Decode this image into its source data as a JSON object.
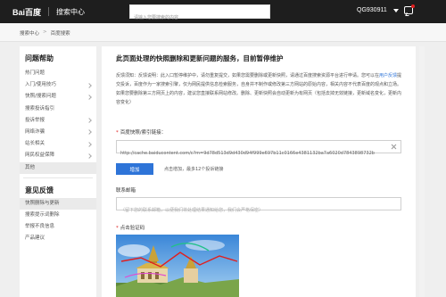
{
  "header": {
    "logo_text": "Bai百度",
    "logo_sub": "搜索中心",
    "search_placeholder": "请输入您要搜索的内容",
    "user_name": "QG930911",
    "colors": {
      "bar": "#1e1e1e",
      "accent": "#2e5bff"
    }
  },
  "breadcrumb": {
    "items": [
      "搜索中心",
      "百度搜索"
    ],
    "separator": ">"
  },
  "sidebar": {
    "title": "问题帮助",
    "items": [
      {
        "label": "热门问题",
        "has_chevron": false
      },
      {
        "label": "入门/使用技巧",
        "has_chevron": true
      },
      {
        "label": "快照/搜索问题",
        "has_chevron": true
      },
      {
        "label": "搜索投诉指引",
        "has_chevron": false
      },
      {
        "label": "投诉举报",
        "has_chevron": true
      },
      {
        "label": "网络诈骗",
        "has_chevron": true
      },
      {
        "label": "站长相关",
        "has_chevron": true
      },
      {
        "label": "网民权益保障",
        "has_chevron": true
      },
      {
        "label": "其他",
        "has_chevron": false,
        "active": true
      }
    ],
    "title2": "意见反馈",
    "feedback_items": [
      {
        "label": "快照删除与更新",
        "active": true
      },
      {
        "label": "搜索提示词删除"
      },
      {
        "label": "举报不良信息"
      },
      {
        "label": "产品建议"
      }
    ]
  },
  "main": {
    "page_title": "此页面处理的快照删除和更新问题的服务，目前暂停维护",
    "notice_before_link": "反馈须知：反馈说明：此入口暂停维护中，请勿重复提交，如果您需要删除或更新快照，请通过百度搜索资源平台进行申请。您可以在",
    "notice_link": "用户反馈",
    "notice_after_link": "提交投诉，百度作为一家搜索引擎，仅为网民提供信息检索服务，自身并不制作或修改第三方网站的原始内容，相关内容不代表百度的观点和立场。如果您要删除第三方网页上的内容，建议您直接联系网站修改。删除、更新快照会自动更新为有网页（包括去掉无效链接，更新域名变化，更新内容变化）",
    "url_label": "百度快照/索引链接：",
    "url_value": "http://cache.baiducontent.com/c?m=9d78d513d9d430d94f999e697b11c0166e4381132ba7a6020d7843898732b",
    "add_button": "增加",
    "add_hint": "点击增加，最多12个投诉链接",
    "email_label": "联系邮箱",
    "email_placeholder": "（留下您的联系邮箱，以便我们将处理结果通知给您，我们会严格保密）",
    "captcha_label": "点击验证码"
  }
}
